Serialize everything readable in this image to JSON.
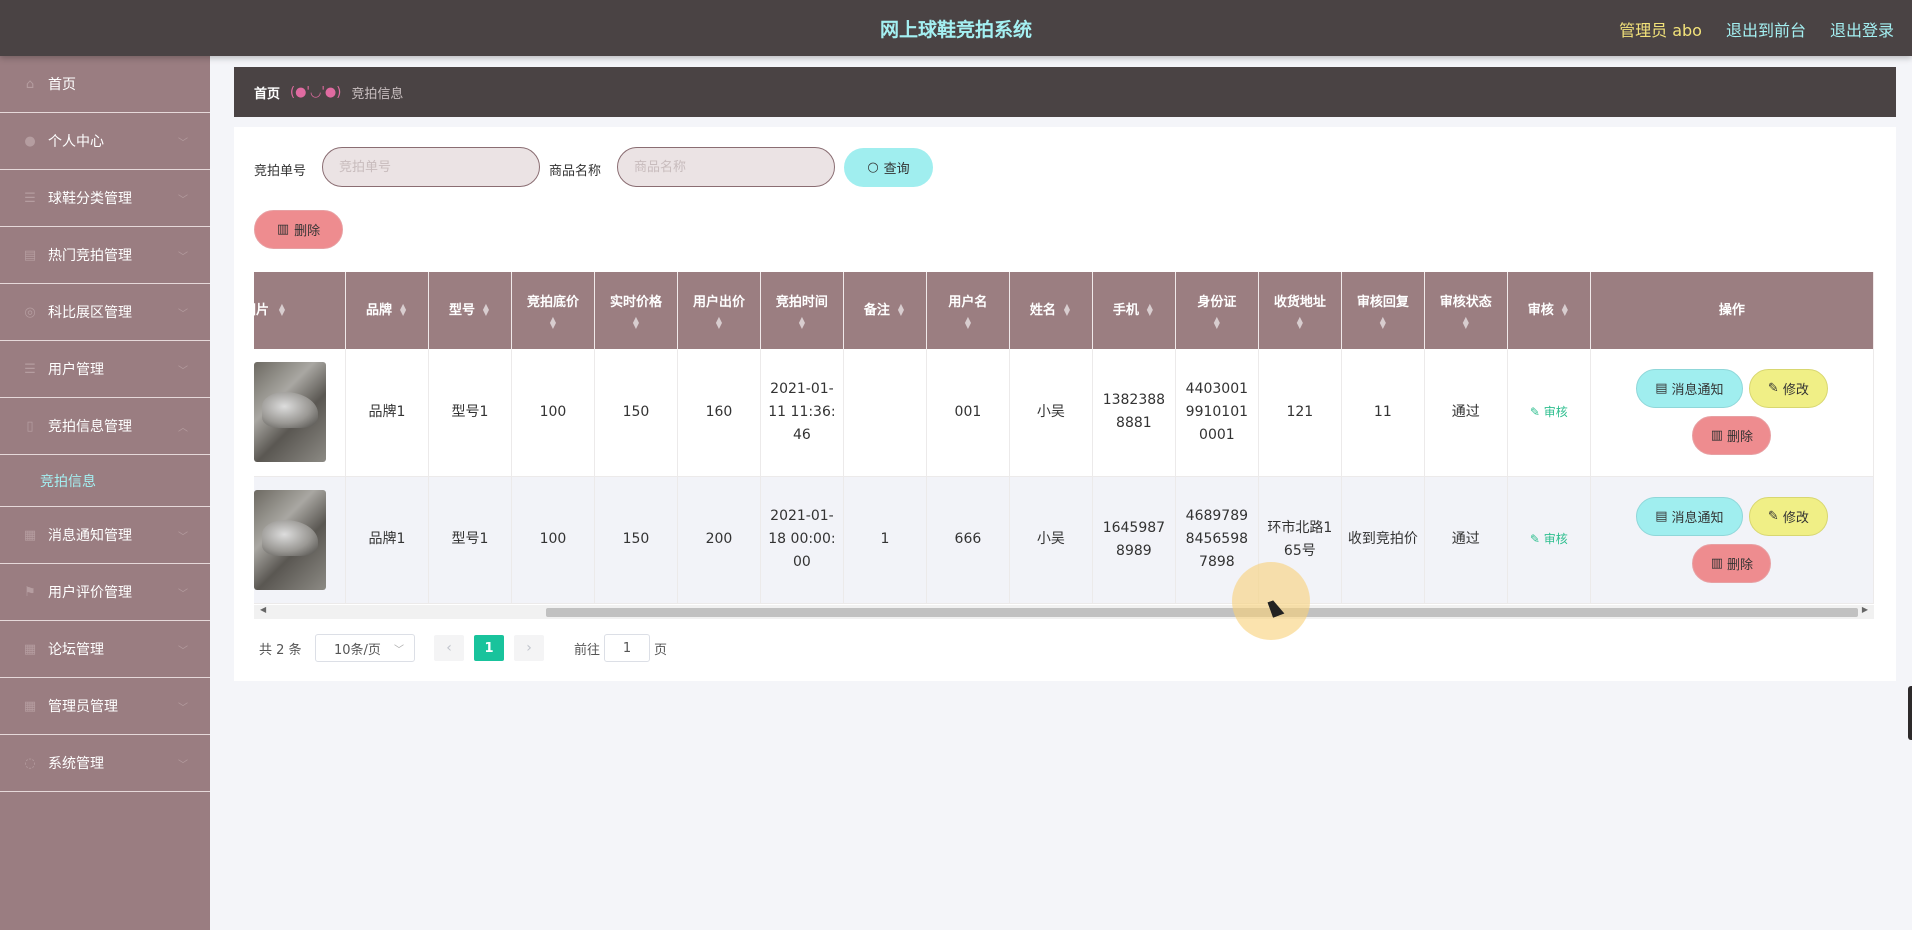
{
  "header": {
    "title": "网上球鞋竞拍系统",
    "user": "管理员 abo",
    "to_front": "退出到前台",
    "logout": "退出登录"
  },
  "sidebar": {
    "items": [
      {
        "label": "首页",
        "icon": "home-icon"
      },
      {
        "label": "个人中心",
        "icon": "user-icon"
      },
      {
        "label": "球鞋分类管理",
        "icon": "list-icon"
      },
      {
        "label": "热门竞拍管理",
        "icon": "fire-icon"
      },
      {
        "label": "科比展区管理",
        "icon": "star-icon"
      },
      {
        "label": "用户管理",
        "icon": "list-icon"
      },
      {
        "label": "竞拍信息管理",
        "icon": "doc-icon"
      },
      {
        "label": "消息通知管理",
        "icon": "grid-icon"
      },
      {
        "label": "用户评价管理",
        "icon": "flag-icon"
      },
      {
        "label": "论坛管理",
        "icon": "grid-icon"
      },
      {
        "label": "管理员管理",
        "icon": "grid-icon"
      },
      {
        "label": "系统管理",
        "icon": "gear-icon"
      }
    ],
    "active_sub": "竞拍信息"
  },
  "breadcrumb": {
    "home": "首页",
    "separator": "(●'◡'●)",
    "current": "竞拍信息"
  },
  "search": {
    "order_label": "竞拍单号",
    "order_placeholder": "竞拍单号",
    "name_label": "商品名称",
    "name_placeholder": "商品名称",
    "query_button": "查询"
  },
  "toolbar": {
    "delete_button": "删除"
  },
  "table": {
    "columns": [
      "图片",
      "品牌",
      "型号",
      "竞拍底价",
      "实时价格",
      "用户出价",
      "竞拍时间",
      "备注",
      "用户名",
      "姓名",
      "手机",
      "身份证",
      "收货地址",
      "审核回复",
      "审核状态",
      "审核",
      "操作"
    ],
    "rows": [
      {
        "brand": "品牌1",
        "model": "型号1",
        "base_price": "100",
        "current_price": "150",
        "bid": "160",
        "time": "2021-01-11 11:36:46",
        "remark": "",
        "username": "001",
        "name": "小吴",
        "phone": "13823888881",
        "id_card": "440300199101010001",
        "address": "121",
        "reply": "11",
        "status": "通过",
        "audit": "审核"
      },
      {
        "brand": "品牌1",
        "model": "型号1",
        "base_price": "100",
        "current_price": "150",
        "bid": "200",
        "time": "2021-01-18 00:00:00",
        "remark": "1",
        "username": "666",
        "name": "小吴",
        "phone": "16459878989",
        "id_card": "468978984565987898",
        "address": "环市北路165号",
        "reply": "收到竞拍价",
        "status": "通过",
        "audit": "审核"
      }
    ],
    "actions": {
      "notify": "消息通知",
      "edit": "修改",
      "delete": "删除"
    }
  },
  "pagination": {
    "total": "共 2 条",
    "page_size": "10条/页",
    "current_page": "1",
    "goto_label": "前往",
    "goto_value": "1",
    "page_unit": "页"
  },
  "colors": {
    "header_bg": "#4a4344",
    "sidebar_bg": "#9a7d81",
    "accent_cyan": "#a0eeef",
    "accent_red": "#ee8c8f",
    "accent_yellow": "#f0ef86",
    "pager_green": "#19c39c"
  }
}
